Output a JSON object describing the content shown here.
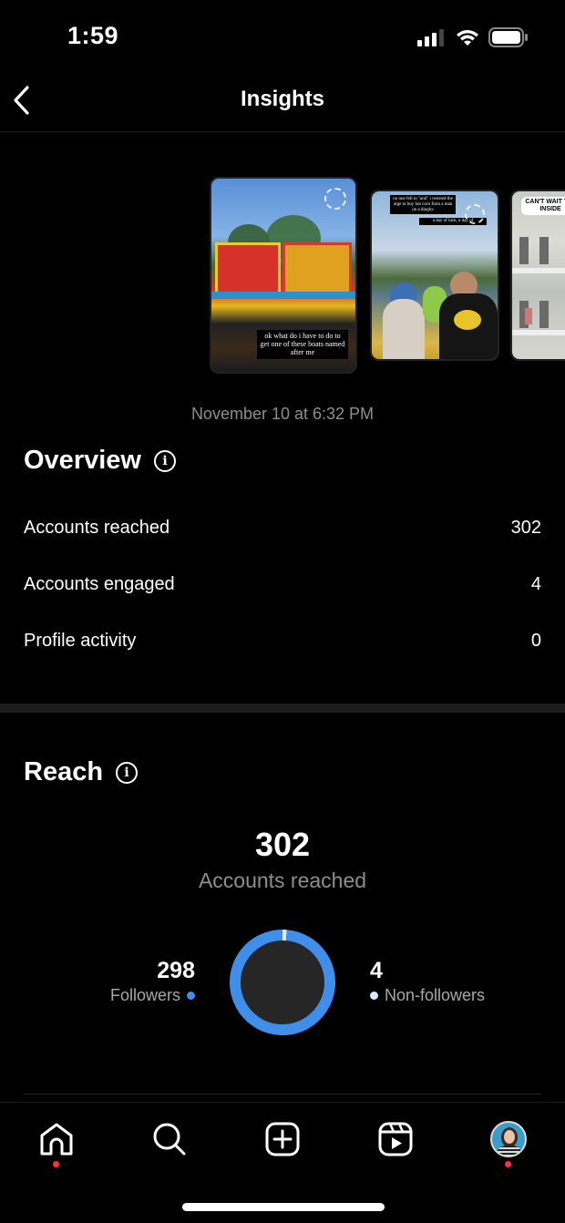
{
  "status_bar": {
    "time": "1:59",
    "icons": [
      "cellular-signal-icon",
      "wifi-icon",
      "battery-icon"
    ]
  },
  "header": {
    "title": "Insights",
    "back_icon": "chevron-left-icon"
  },
  "stories": [
    {
      "caption": "ok what do i have to do to get one of these boats named after me",
      "selected": true
    },
    {
      "caption": "no one fell in \"and\" i resisted the urge to buy hot corn from a man on a dinghy",
      "caption_2": "a day of luck, a day of",
      "selected": false
    },
    {
      "caption": "CAN'T WAIT T IS INSIDE",
      "selected": false
    }
  ],
  "post_date": "November 10 at 6:32 PM",
  "overview": {
    "title": "Overview",
    "metrics": [
      {
        "label": "Accounts reached",
        "value": "302"
      },
      {
        "label": "Accounts engaged",
        "value": "4"
      },
      {
        "label": "Profile activity",
        "value": "0"
      }
    ]
  },
  "reach": {
    "title": "Reach",
    "total": "302",
    "total_label": "Accounts reached",
    "followers": {
      "value": "298",
      "label": "Followers",
      "color": "#3f8ee9"
    },
    "non_followers": {
      "value": "4",
      "label": "Non-followers",
      "color": "#dbe9fb"
    },
    "donut": {
      "followers": 298,
      "non_followers": 4
    }
  },
  "tab_bar": {
    "items": [
      {
        "name": "home",
        "icon": "home-icon",
        "badge": true
      },
      {
        "name": "search",
        "icon": "search-icon",
        "badge": false
      },
      {
        "name": "create",
        "icon": "plus-square-icon",
        "badge": false
      },
      {
        "name": "reels",
        "icon": "reels-icon",
        "badge": false
      },
      {
        "name": "profile",
        "icon": "avatar",
        "badge": true
      }
    ]
  },
  "colors": {
    "background": "#000000",
    "accent_blue": "#3f8ee9",
    "badge_red": "#ff3040",
    "secondary_text": "#8e8e8e"
  }
}
